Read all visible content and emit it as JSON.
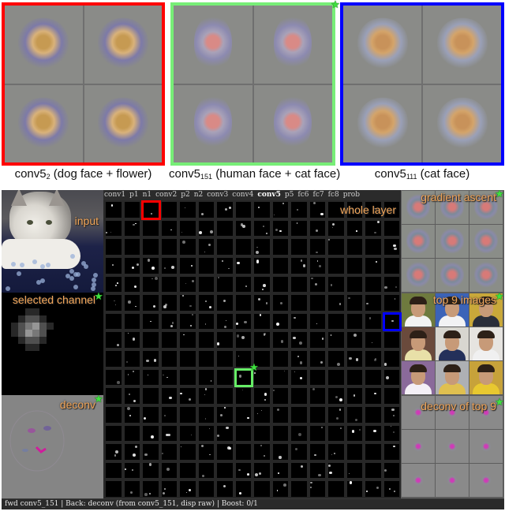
{
  "figure": {
    "panels": [
      {
        "id": "conv5_2",
        "caption_base": "conv5",
        "caption_sub": "2",
        "caption_rest": " (dog face + flower)",
        "frame_color": "#ff0000",
        "theme": "dog",
        "starred": false
      },
      {
        "id": "conv5_151",
        "caption_base": "conv5",
        "caption_sub": "151",
        "caption_rest": " (human face + cat face)",
        "frame_color": "#77ee77",
        "theme": "human",
        "starred": true
      },
      {
        "id": "conv5_111",
        "caption_base": "conv5",
        "caption_sub": "111",
        "caption_rest": " (cat face)",
        "frame_color": "#0000ff",
        "theme": "cat",
        "starred": false
      }
    ]
  },
  "app": {
    "left": {
      "input_label": "input",
      "selected_channel_label": "selected channel",
      "deconv_label": "deconv"
    },
    "layer_tabs": [
      "conv1",
      "p1",
      "n1",
      "conv2",
      "p2",
      "n2",
      "conv3",
      "conv4",
      "conv5",
      "p5",
      "fc6",
      "fc7",
      "fc8",
      "prob"
    ],
    "active_layer": "conv5",
    "whole_layer_label": "whole layer",
    "grid": {
      "columns": 16,
      "rows": 16
    },
    "highlights": [
      {
        "unit": "conv5_2",
        "color": "#ff0000",
        "col": 2,
        "row": 0
      },
      {
        "unit": "conv5_151",
        "color": "#66ee66",
        "col": 7,
        "row": 9,
        "starred": true
      },
      {
        "unit": "conv5_111",
        "color": "#0000ff",
        "col": 15,
        "row": 6
      }
    ],
    "right": {
      "gradient_ascent_label": "gradient ascent",
      "top9_label": "top 9 images",
      "deconv_top9_label": "deconv of top 9"
    },
    "status_bar": "fwd conv5_151 | Back: deconv (from conv5_151, disp raw) | Boost: 0/1"
  }
}
